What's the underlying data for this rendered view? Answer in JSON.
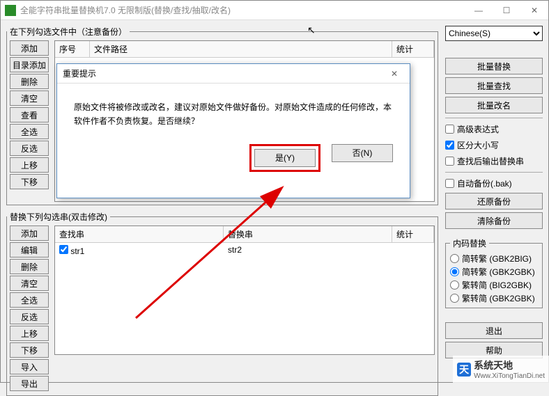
{
  "window": {
    "title": "全能字符串批量替换机7.0 无限制版(替换/查找/抽取/改名)"
  },
  "sysbuttons": {
    "min": "—",
    "max": "☐",
    "close": "✕"
  },
  "section_files": {
    "legend": "在下列勾选文件中（注意备份）",
    "header_seq": "序号",
    "header_path": "文件路径",
    "header_stats": "统计"
  },
  "left1": {
    "add": "添加",
    "dir_add": "目录添加",
    "delete": "删除",
    "clear": "清空",
    "view": "查看",
    "select_all": "全选",
    "invert": "反选",
    "up": "上移",
    "down": "下移"
  },
  "right": {
    "language_selected": "Chinese(S)",
    "batch_replace": "批量替换",
    "batch_find": "批量查找",
    "batch_rename": "批量改名",
    "adv_expr": "高级表达式",
    "case_sensitive": "区分大小写",
    "output_replace_str": "查找后输出替换串",
    "auto_backup": "自动备份(.bak)",
    "restore_backup": "还原备份",
    "clear_backup": "清除备份",
    "encoding_legend": "内码替换",
    "enc_gbk2big": "简转繁 (GBK2BIG)",
    "enc_gbk2gbk": "简转繁 (GBK2GBK)",
    "enc_big2gbk": "繁转简 (BIG2GBK)",
    "enc_gbk2gbk2": "繁转简 (GBK2GBK)",
    "exit": "退出",
    "help": "帮助"
  },
  "section_strings": {
    "legend": "替换下列勾选串(双击修改)",
    "header_find": "查找串",
    "header_replace": "替换串",
    "header_stats": "统计",
    "rows": [
      {
        "find": "str1",
        "replace": "str2",
        "checked": true
      }
    ]
  },
  "left2": {
    "add": "添加",
    "edit": "编辑",
    "delete": "删除",
    "clear": "清空",
    "select_all": "全选",
    "invert": "反选",
    "up": "上移",
    "down": "下移",
    "import": "导入",
    "export": "导出"
  },
  "modal": {
    "title": "重要提示",
    "body": "原始文件将被修改或改名，建议对原始文件做好备份。对原始文件造成的任何修改，本软件作者不负责恢复。是否继续？",
    "yes": "是(Y)",
    "no": "否(N)"
  },
  "watermark": {
    "name": "系统天地",
    "url": "Www.XiTongTianDi.net"
  }
}
